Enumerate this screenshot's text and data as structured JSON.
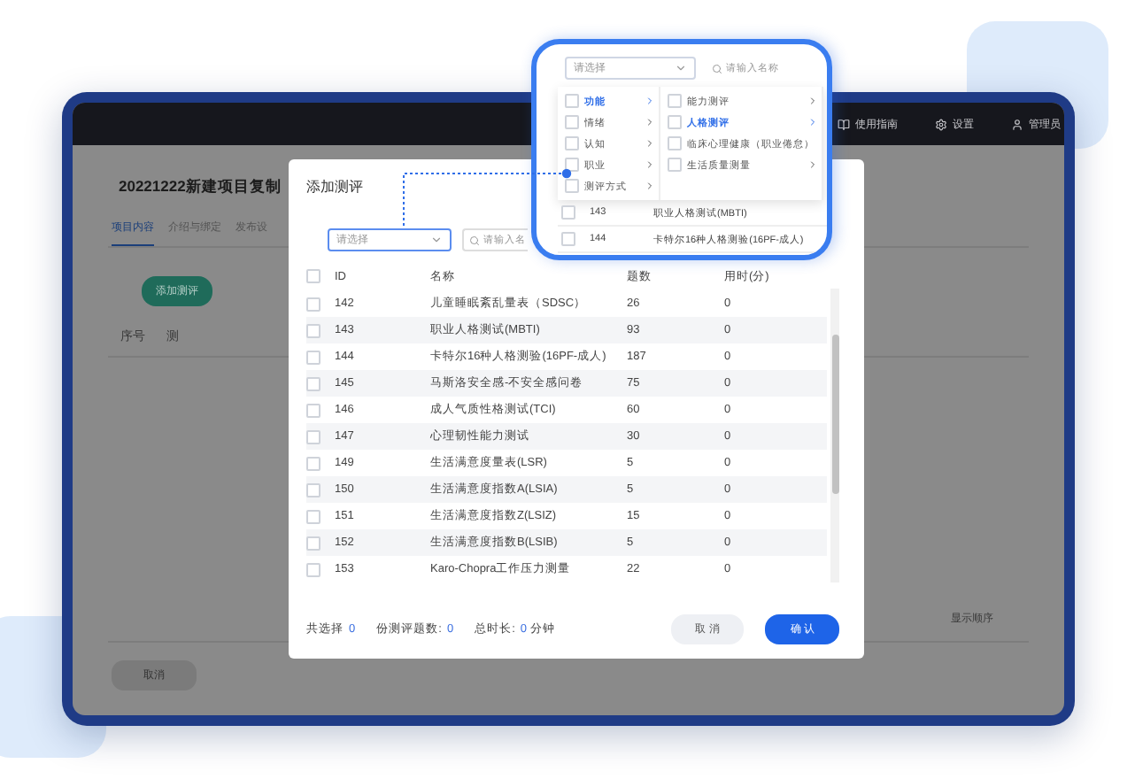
{
  "topbar": {
    "items": [
      {
        "kind": "guide",
        "label": "使用指南"
      },
      {
        "kind": "settings",
        "label": "设置"
      },
      {
        "kind": "user",
        "label": "管理员"
      }
    ]
  },
  "page": {
    "title": "20221222新建项目复制",
    "tabs": [
      {
        "label": "项目内容",
        "selected": true
      },
      {
        "label": "介绍与绑定",
        "selected": false
      },
      {
        "label": "发布设",
        "selected": false
      }
    ],
    "add_button": "添加测评",
    "columns": [
      "序号",
      "测"
    ],
    "order_column": "显示顺序",
    "cancel_button": "取消"
  },
  "dialog": {
    "title": "添加测评",
    "select": {
      "placeholder": "请选择"
    },
    "search": {
      "placeholder": "请输入名"
    },
    "columns": [
      "ID",
      "名称",
      "题数",
      "用时(分)"
    ],
    "select_all_checked": false,
    "rows": [
      {
        "id": "142",
        "name": "儿童睡眠紊乱量表（SDSC）",
        "count": "26",
        "time": "0",
        "checked": false
      },
      {
        "id": "143",
        "name": "职业人格测试(MBTI)",
        "count": "93",
        "time": "0",
        "checked": false
      },
      {
        "id": "144",
        "name": "卡特尔16种人格测验(16PF-成人)",
        "count": "187",
        "time": "0",
        "checked": false
      },
      {
        "id": "145",
        "name": "马斯洛安全感-不安全感问卷",
        "count": "75",
        "time": "0",
        "checked": false
      },
      {
        "id": "146",
        "name": "成人气质性格测试(TCI)",
        "count": "60",
        "time": "0",
        "checked": false
      },
      {
        "id": "147",
        "name": "心理韧性能力测试",
        "count": "30",
        "time": "0",
        "checked": false
      },
      {
        "id": "149",
        "name": "生活满意度量表(LSR)",
        "count": "5",
        "time": "0",
        "checked": false
      },
      {
        "id": "150",
        "name": "生活满意度指数A(LSIA)",
        "count": "5",
        "time": "0",
        "checked": false
      },
      {
        "id": "151",
        "name": "生活满意度指数Z(LSIZ)",
        "count": "15",
        "time": "0",
        "checked": false
      },
      {
        "id": "152",
        "name": "生活满意度指数B(LSIB)",
        "count": "5",
        "time": "0",
        "checked": false
      },
      {
        "id": "153",
        "name": "Karo-Chopra工作压力测量",
        "count": "22",
        "time": "0",
        "checked": false
      }
    ],
    "summary": [
      {
        "label": "共选择",
        "value": "0"
      },
      {
        "label": "份测评题数:",
        "value": "0"
      },
      {
        "label": "总时长:",
        "value": "0",
        "unit": "分钟"
      }
    ],
    "buttons": [
      {
        "kind": "secondary",
        "label": "取 消"
      },
      {
        "kind": "primary",
        "label": "确 认"
      }
    ]
  },
  "callout": {
    "select": {
      "placeholder": "请选择"
    },
    "search": {
      "placeholder": "请输入名称"
    },
    "categories": [
      {
        "label": "功能",
        "selected": true
      },
      {
        "label": "情绪",
        "selected": false
      },
      {
        "label": "认知",
        "selected": false
      },
      {
        "label": "职业",
        "selected": false
      },
      {
        "label": "测评方式",
        "selected": false
      }
    ],
    "subcategories": [
      {
        "label": "能力测评",
        "selected": false
      },
      {
        "label": "人格测评",
        "selected": true
      },
      {
        "label": "临床心理健康（职业倦怠）",
        "selected": false
      },
      {
        "label": "生活质量测量",
        "selected": false
      }
    ],
    "rows": [
      {
        "id": "143",
        "name": "职业人格测试(MBTI)",
        "checked": false
      },
      {
        "id": "144",
        "name": "卡特尔16种人格测验(16PF-成人)",
        "checked": false
      }
    ]
  }
}
